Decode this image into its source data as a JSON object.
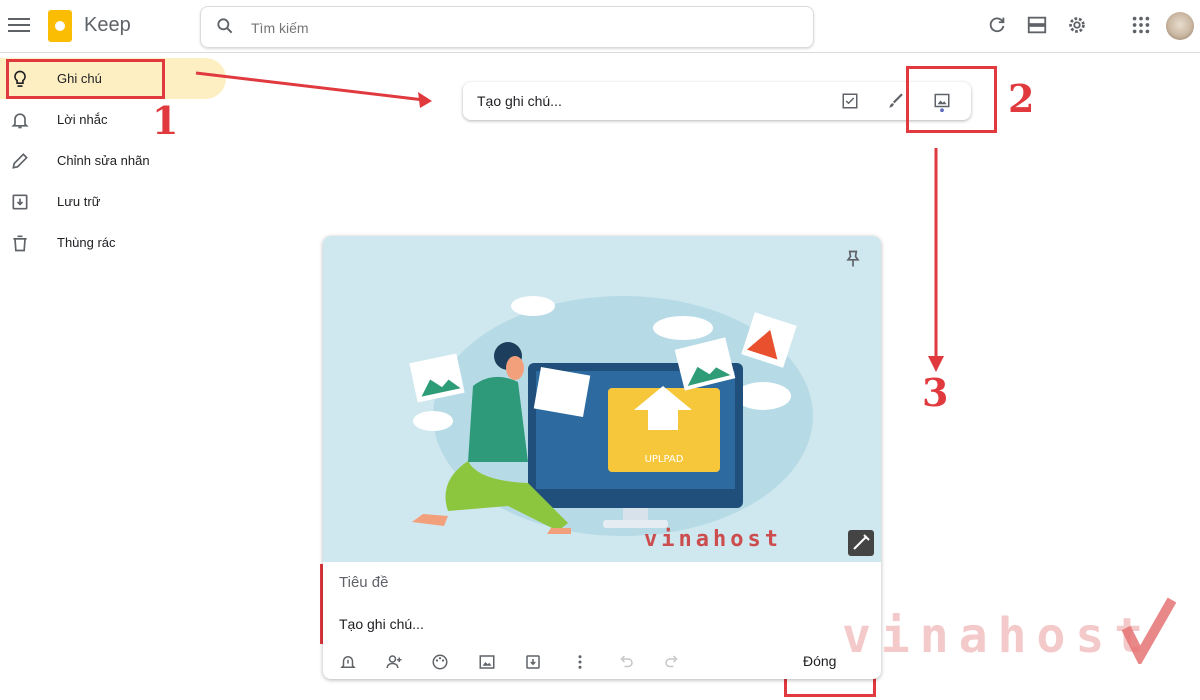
{
  "app": {
    "title": "Keep"
  },
  "search": {
    "placeholder": "Tìm kiếm"
  },
  "sidebar": {
    "items": [
      {
        "label": "Ghi chú",
        "icon": "lightbulb-icon",
        "active": true
      },
      {
        "label": "Lời nhắc",
        "icon": "bell-icon"
      },
      {
        "label": "Chỉnh sửa nhãn",
        "icon": "pencil-icon"
      },
      {
        "label": "Lưu trữ",
        "icon": "archive-icon"
      },
      {
        "label": "Thùng rác",
        "icon": "trash-icon"
      }
    ]
  },
  "take_note": {
    "placeholder": "Tạo ghi chú..."
  },
  "editor": {
    "title_placeholder": "Tiêu đề",
    "note_placeholder": "Tạo ghi chú...",
    "close_label": "Đóng",
    "image_text": "UPLPAD",
    "image_watermark": "vinahost"
  },
  "annotations": {
    "step1": "1",
    "step2": "2",
    "step3": "3"
  },
  "watermark": {
    "text": "vinahost"
  },
  "colors": {
    "accent": "#fbbc04",
    "active_bg": "#feefc3",
    "annotation": "#e0393e"
  }
}
